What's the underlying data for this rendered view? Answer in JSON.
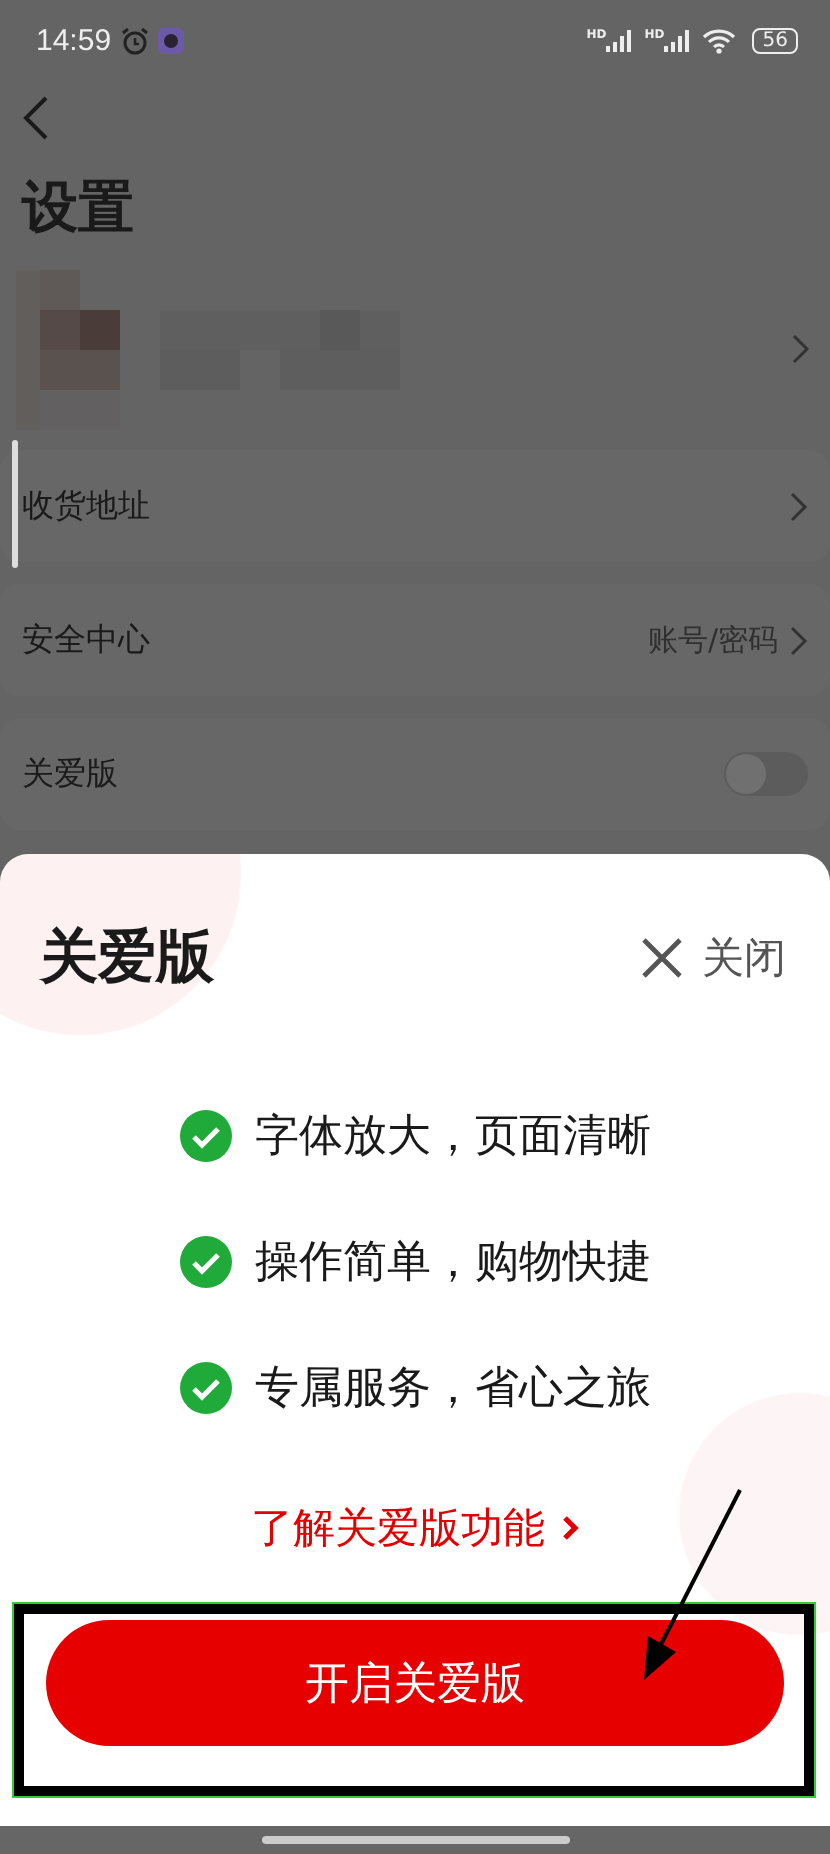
{
  "status_bar": {
    "time": "14:59",
    "signal_labels": [
      "HD",
      "HD"
    ],
    "battery": "56"
  },
  "header": {
    "title": "设置"
  },
  "settings": [
    {
      "kind": "profile"
    },
    {
      "kind": "link",
      "label": "收货地址"
    },
    {
      "kind": "link",
      "label": "安全中心",
      "value": "账号/密码"
    },
    {
      "kind": "toggle",
      "label": "关爱版",
      "on": false
    }
  ],
  "sheet": {
    "title": "关爱版",
    "close_label": "关闭",
    "features": [
      "字体放大，页面清晰",
      "操作简单，购物快捷",
      "专属服务，省心之旅"
    ],
    "link": "了解关爱版功能",
    "button": "开启关爱版"
  }
}
